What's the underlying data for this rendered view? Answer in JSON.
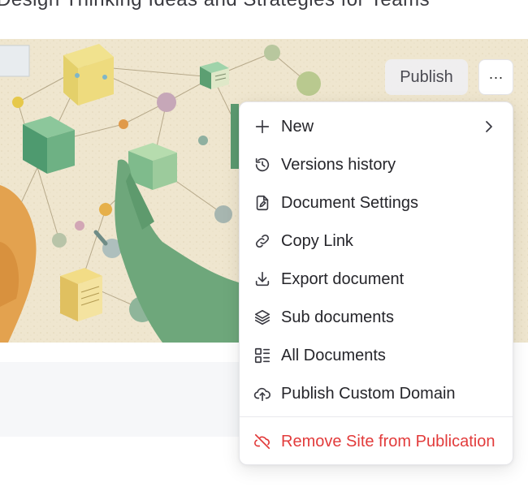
{
  "header": {
    "cut_text": "Design Thinking Ideas and Strategies for Teams"
  },
  "actions": {
    "publish_label": "Publish",
    "more_label": "···"
  },
  "menu": {
    "items": [
      {
        "label": "New",
        "icon": "plus-icon",
        "has_submenu": true
      },
      {
        "label": "Versions history",
        "icon": "history-icon"
      },
      {
        "label": "Document Settings",
        "icon": "document-settings-icon"
      },
      {
        "label": "Copy Link",
        "icon": "link-icon"
      },
      {
        "label": "Export document",
        "icon": "download-icon"
      },
      {
        "label": "Sub documents",
        "icon": "layers-icon"
      },
      {
        "label": "All Documents",
        "icon": "list-grid-icon"
      },
      {
        "label": "Publish Custom Domain",
        "icon": "cloud-upload-icon"
      }
    ],
    "danger_item": {
      "label": "Remove Site from Publication",
      "icon": "cloud-off-icon"
    }
  },
  "colors": {
    "danger": "#e23b3b",
    "icon": "#3a3a42"
  }
}
